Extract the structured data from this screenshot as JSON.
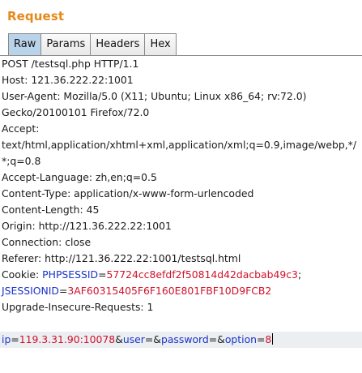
{
  "panel": {
    "title": "Request"
  },
  "tabs": [
    {
      "label": "Raw",
      "active": true
    },
    {
      "label": "Params",
      "active": false
    },
    {
      "label": "Headers",
      "active": false
    },
    {
      "label": "Hex",
      "active": false
    }
  ],
  "request": {
    "lines": [
      "POST /testsql.php HTTP/1.1",
      "Host: 121.36.222.22:1001",
      "User-Agent: Mozilla/5.0 (X11; Ubuntu; Linux x86_64; rv:72.0)",
      "Gecko/20100101 Firefox/72.0",
      "Accept:",
      "text/html,application/xhtml+xml,application/xml;q=0.9,image/webp,*/",
      "*;q=0.8",
      "Accept-Language: zh,en;q=0.5",
      "Content-Type: application/x-www-form-urlencoded",
      "Content-Length: 45",
      "Origin: http://121.36.222.22:1001",
      "Connection: close",
      "Referer: http://121.36.222.22:1001/testsql.html"
    ],
    "cookie": {
      "label": "Cookie: ",
      "phpsessid_key": "PHPSESSID",
      "eq1": "=",
      "phpsessid_value": "57724cc8efdf2f50814d42dacbab49c3",
      "sep": ";",
      "jsessionid_key": "JSESSIONID",
      "eq2": "=",
      "jsessionid_value": "3AF60315405F6F160E801FBF10D9FCB2"
    },
    "upgrade_line": "Upgrade-Insecure-Requests: 1",
    "body": {
      "ip_key": "ip",
      "eq1": "=",
      "ip_value": "119.3.31.90:10078",
      "amp1": "&",
      "user_key": "user",
      "eq2": "=",
      "amp2": "&",
      "password_key": "password",
      "eq3": "=",
      "amp3": "&",
      "option_key": "option",
      "eq4": "=",
      "option_value": "8"
    }
  },
  "colors": {
    "title": "#e5891a",
    "active_tab": "#b9d3ea",
    "param_key": "#1a33c8",
    "param_value": "#d0112b",
    "body_highlight": "#eceff2"
  }
}
